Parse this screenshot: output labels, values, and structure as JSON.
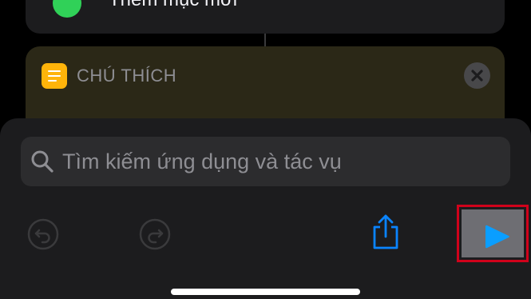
{
  "top_card": {
    "label": "Thêm mục mới",
    "icon": "plus-circle-icon",
    "icon_color": "#30d158"
  },
  "comment_action": {
    "title": "CHÚ THÍCH",
    "icon": "comment-lines-icon",
    "icon_color": "#ffb40a",
    "close_icon": "close-icon"
  },
  "search": {
    "placeholder": "Tìm kiếm ứng dụng và tác vụ",
    "value": "",
    "icon": "search-icon"
  },
  "toolbar": {
    "undo_icon": "undo-icon",
    "redo_icon": "redo-icon",
    "share_icon": "share-icon",
    "play_icon": "play-icon",
    "accent": "#0a84ff"
  },
  "colors": {
    "background": "#000000",
    "sheet": "#1c1c1e",
    "highlight_border": "#d0021b"
  }
}
